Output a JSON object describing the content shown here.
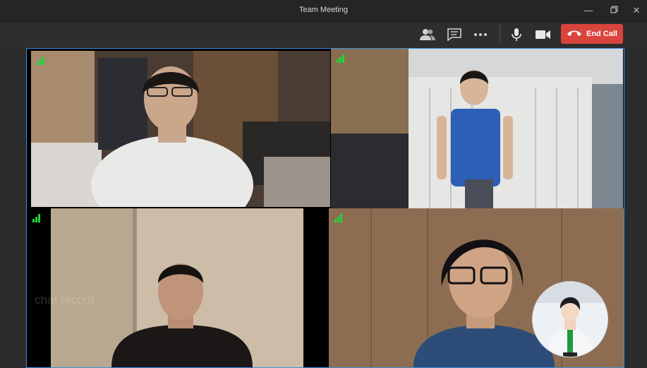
{
  "window": {
    "title": "Team Meeting"
  },
  "toolbar": {
    "end_call_label": "End Call"
  },
  "overlay": {
    "chat_record_label": "chat record"
  },
  "participants": [
    {
      "tile": "top-left"
    },
    {
      "tile": "top-right"
    },
    {
      "tile": "bottom-left"
    },
    {
      "tile": "bottom-right"
    }
  ],
  "colors": {
    "accent_border": "#3a8fe6",
    "end_call": "#d9443c",
    "signal": "#21d43a"
  },
  "icons": [
    "minimize-icon",
    "maximize-icon",
    "close-icon",
    "participants-icon",
    "chat-icon",
    "more-icon",
    "microphone-icon",
    "camera-icon",
    "phone-hangup-icon",
    "signal-icon"
  ]
}
